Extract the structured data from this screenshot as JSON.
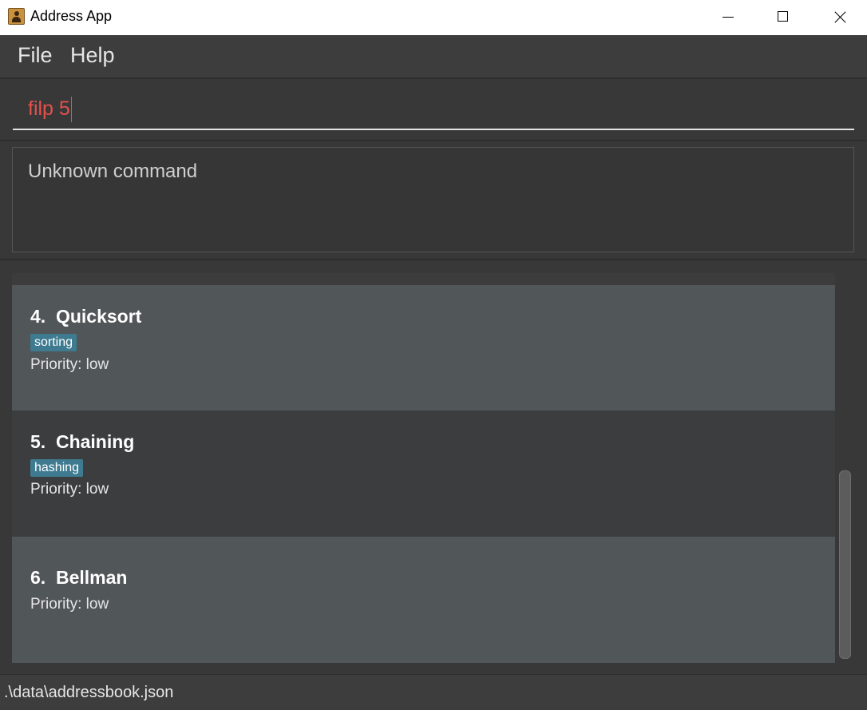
{
  "window": {
    "title": "Address App",
    "icon": "address-book-icon",
    "controls": [
      "minimize-icon",
      "maximize-icon",
      "close-icon"
    ]
  },
  "menu": {
    "file": "File",
    "help": "Help"
  },
  "command": {
    "value": "filp 5"
  },
  "result": {
    "message": "Unknown command"
  },
  "list": {
    "items": [
      {
        "index": "4.",
        "name": "Quicksort",
        "tag": "sorting",
        "priority": "Priority: low"
      },
      {
        "index": "5.",
        "name": "Chaining",
        "tag": "hashing",
        "priority": "Priority: low"
      },
      {
        "index": "6.",
        "name": "Bellman",
        "priority": "Priority: low"
      }
    ]
  },
  "status": {
    "path": ".\\data\\addressbook.json"
  },
  "colors": {
    "command_text": "#e6504c",
    "tag_bg": "#3e7b91",
    "card_light": "#515658",
    "card_dark": "#3c3d3f"
  }
}
